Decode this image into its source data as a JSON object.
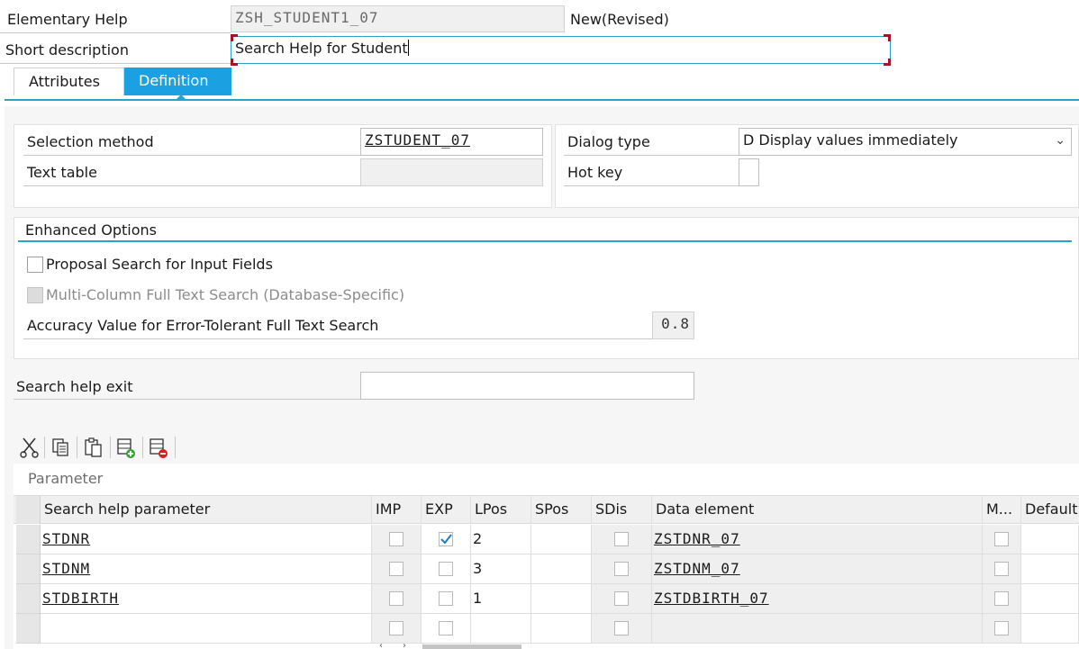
{
  "header": {
    "elementary_help_label": "Elementary Help",
    "elementary_help_value": "ZSH_STUDENT1_07",
    "status": "New(Revised)",
    "short_desc_label": "Short description",
    "short_desc_value": "Search Help for Student"
  },
  "tabs": [
    {
      "label": "Attributes",
      "active": false
    },
    {
      "label": "Definition",
      "active": true
    }
  ],
  "definition": {
    "selection_method_label": "Selection method",
    "selection_method_value": "ZSTUDENT_07",
    "text_table_label": "Text table",
    "text_table_value": "",
    "dialog_type_label": "Dialog type",
    "dialog_type_value": "D Display values immediately",
    "hot_key_label": "Hot key",
    "hot_key_value": ""
  },
  "enhanced": {
    "title": "Enhanced Options",
    "proposal_label": "Proposal Search for Input Fields",
    "proposal_checked": false,
    "multicol_label": "Multi-Column Full Text Search (Database-Specific)",
    "multicol_enabled": false,
    "accuracy_label": "Accuracy Value for Error-Tolerant Full Text Search",
    "accuracy_value": "0.8"
  },
  "exit": {
    "label": "Search help exit",
    "value": ""
  },
  "toolbar": [
    {
      "icon": "cut-icon"
    },
    {
      "icon": "copy-icon"
    },
    {
      "icon": "paste-icon"
    },
    {
      "icon": "insert-row-icon"
    },
    {
      "icon": "delete-row-icon"
    }
  ],
  "params": {
    "title": "Parameter",
    "columns": [
      "Search help parameter",
      "IMP",
      "EXP",
      "LPos",
      "SPos",
      "SDis",
      "Data element",
      "M...",
      "Default"
    ],
    "rows": [
      {
        "param": "STDNR",
        "imp": false,
        "exp": true,
        "lpos": "2",
        "spos": "",
        "sdis": false,
        "data_element": "ZSTDNR_07",
        "m": false
      },
      {
        "param": "STDNM",
        "imp": false,
        "exp": false,
        "lpos": "3",
        "spos": "",
        "sdis": false,
        "data_element": "ZSTDNM_07",
        "m": false
      },
      {
        "param": "STDBIRTH",
        "imp": false,
        "exp": false,
        "lpos": "1",
        "spos": "",
        "sdis": false,
        "data_element": "ZSTDBIRTH_07",
        "m": false
      },
      {
        "param": "",
        "imp": false,
        "exp": false,
        "lpos": "",
        "spos": "",
        "sdis": false,
        "data_element": "",
        "m": false
      }
    ]
  },
  "colors": {
    "accent": "#2aa3c8",
    "tab_active": "#1ba1e2",
    "focus_corner": "#a3152a"
  }
}
